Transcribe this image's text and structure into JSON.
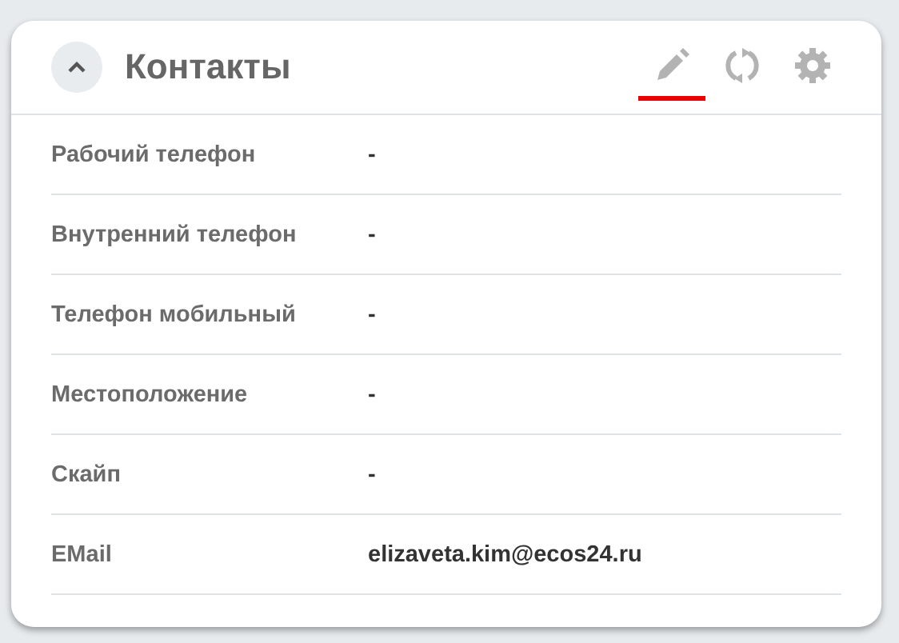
{
  "panel": {
    "title": "Контакты",
    "expanded": true
  },
  "actions": [
    {
      "kind": "edit",
      "selected": true
    },
    {
      "kind": "refresh",
      "selected": false
    },
    {
      "kind": "settings",
      "selected": false
    }
  ],
  "fields": [
    {
      "label": "Рабочий телефон",
      "value": "-"
    },
    {
      "label": "Внутренний телефон",
      "value": "-"
    },
    {
      "label": "Телефон мобильный",
      "value": "-"
    },
    {
      "label": "Местоположение",
      "value": "-"
    },
    {
      "label": "Скайп",
      "value": "-"
    },
    {
      "label": "EMail",
      "value": "elizaveta.kim@ecos24.ru"
    }
  ]
}
